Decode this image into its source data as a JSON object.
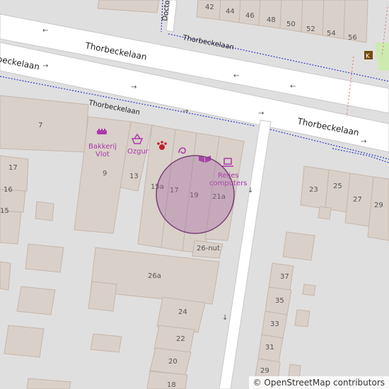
{
  "colors": {
    "background": "#e0dfdf",
    "building": "#d9d0c9",
    "building_stroke": "#c4b6ab",
    "road": "#ffffff",
    "road_casing": "#c8c8c8",
    "path": "#2f3fc7",
    "poi": "#ac39ac",
    "circle": "#a060a0",
    "park": "#cdebb0"
  },
  "streets": {
    "north_a": "Thorbeckelaan",
    "north_b": "Thorbeckelaan",
    "west": "beckelaan",
    "mid": "Thorbeckelaan",
    "east": "Thorbeckelaan",
    "doctor": "Docto"
  },
  "house_numbers": {
    "n42": "42",
    "n44": "44",
    "n46": "46",
    "n48": "48",
    "n50": "50",
    "n52": "52",
    "n54": "54",
    "n56": "56",
    "n7": "7",
    "n9": "9",
    "n13": "13",
    "n15a": "15a",
    "n17": "17",
    "n19": "19",
    "n21a": "21a",
    "n26nut": "26-nut",
    "n26a": "26a",
    "w17": "17",
    "w16": "16",
    "w15": "15",
    "n23": "23",
    "n25": "25",
    "n27": "27",
    "n29": "29",
    "n37": "37",
    "n35": "35",
    "n33": "33",
    "n31": "31",
    "n29b": "29",
    "n24": "24",
    "n22": "22",
    "n20": "20",
    "n18": "18"
  },
  "pois": {
    "bakery": "Bakkerij Vlot",
    "bakery_line1": "Bakkerij",
    "bakery_line2": "Vlot",
    "shop": "Ozgur",
    "computers_line1": "Reijes",
    "computers_line2": "computers"
  },
  "attribution": {
    "symbol": "©",
    "text": "OpenStreetMap contributors"
  }
}
